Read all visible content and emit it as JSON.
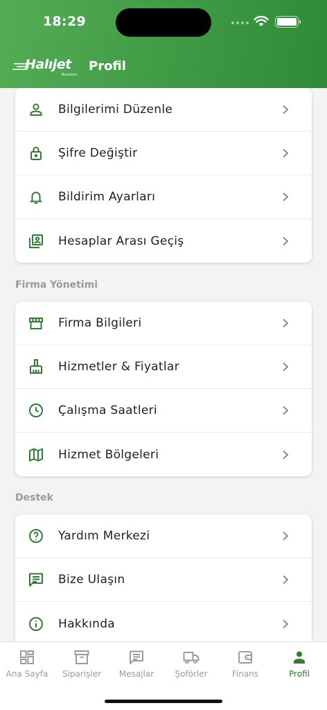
{
  "status_bar": {
    "time": "18:29"
  },
  "header": {
    "logo_text": "Halıjet",
    "logo_subtext": "Business",
    "title": "Profil"
  },
  "colors": {
    "brand_green": "#3f9a44",
    "icon_green": "#2e7d32",
    "section_gray": "#9a9a9a"
  },
  "account_items": [
    {
      "label": "Bilgilerimi Düzenle",
      "icon": "person-icon"
    },
    {
      "label": "Şifre Değiştir",
      "icon": "lock-icon"
    },
    {
      "label": "Bildirim Ayarları",
      "icon": "bell-icon"
    },
    {
      "label": "Hesaplar Arası Geçiş",
      "icon": "account-switch-icon"
    }
  ],
  "sections": {
    "company": {
      "title": "Firma Yönetimi",
      "items": [
        {
          "label": "Firma Bilgileri",
          "icon": "store-icon"
        },
        {
          "label": "Hizmetler & Fiyatlar",
          "icon": "cleaning-brush-icon"
        },
        {
          "label": "Çalışma Saatleri",
          "icon": "clock-icon"
        },
        {
          "label": "Hizmet Bölgeleri",
          "icon": "map-icon"
        }
      ]
    },
    "support": {
      "title": "Destek",
      "items": [
        {
          "label": "Yardım Merkezi",
          "icon": "help-circle-icon"
        },
        {
          "label": "Bize Ulaşın",
          "icon": "message-icon"
        },
        {
          "label": "Hakkında",
          "icon": "info-icon"
        }
      ]
    }
  },
  "tabbar": [
    {
      "label": "Ana Sayfa",
      "icon": "dashboard-icon",
      "active": false
    },
    {
      "label": "Siparişler",
      "icon": "archive-box-icon",
      "active": false
    },
    {
      "label": "Mesajlar",
      "icon": "chat-icon",
      "active": false
    },
    {
      "label": "Şoförler",
      "icon": "truck-icon",
      "active": false
    },
    {
      "label": "Finans",
      "icon": "wallet-icon",
      "active": false
    },
    {
      "label": "Profil",
      "icon": "person-icon",
      "active": true
    }
  ]
}
